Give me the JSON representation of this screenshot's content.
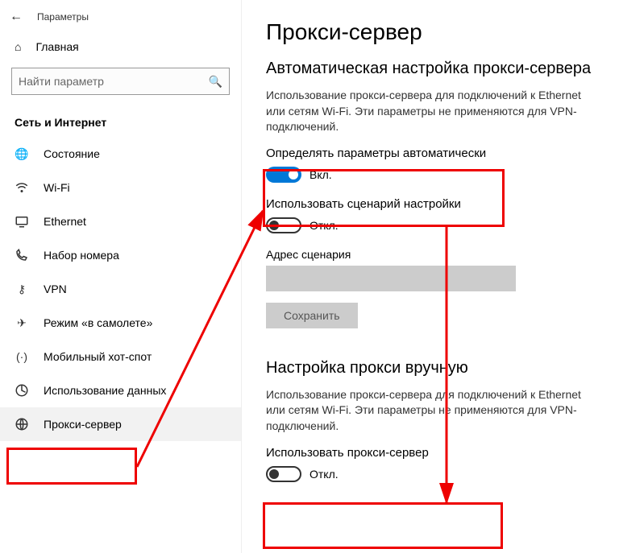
{
  "app_title": "Параметры",
  "home_label": "Главная",
  "search_placeholder": "Найти параметр",
  "section_heading": "Сеть и Интернет",
  "nav": [
    {
      "label": "Состояние"
    },
    {
      "label": "Wi-Fi"
    },
    {
      "label": "Ethernet"
    },
    {
      "label": "Набор номера"
    },
    {
      "label": "VPN"
    },
    {
      "label": "Режим «в самолете»"
    },
    {
      "label": "Мобильный хот-спот"
    },
    {
      "label": "Использование данных"
    },
    {
      "label": "Прокси-сервер"
    }
  ],
  "page_title": "Прокси-сервер",
  "auto_section": {
    "heading": "Автоматическая настройка прокси-сервера",
    "desc": "Использование прокси-сервера для подключений к Ethernet или сетям Wi-Fi. Эти параметры не применяются для VPN-подключений.",
    "detect_label": "Определять параметры автоматически",
    "detect_state": "Вкл.",
    "script_label": "Использовать сценарий настройки",
    "script_state": "Откл.",
    "script_addr_label": "Адрес сценария",
    "save_label": "Сохранить"
  },
  "manual_section": {
    "heading": "Настройка прокси вручную",
    "desc": "Использование прокси-сервера для подключений к Ethernet или сетям Wi-Fi. Эти параметры не применяются для VPN-подключений.",
    "use_proxy_label": "Использовать прокси-сервер",
    "use_proxy_state": "Откл."
  }
}
